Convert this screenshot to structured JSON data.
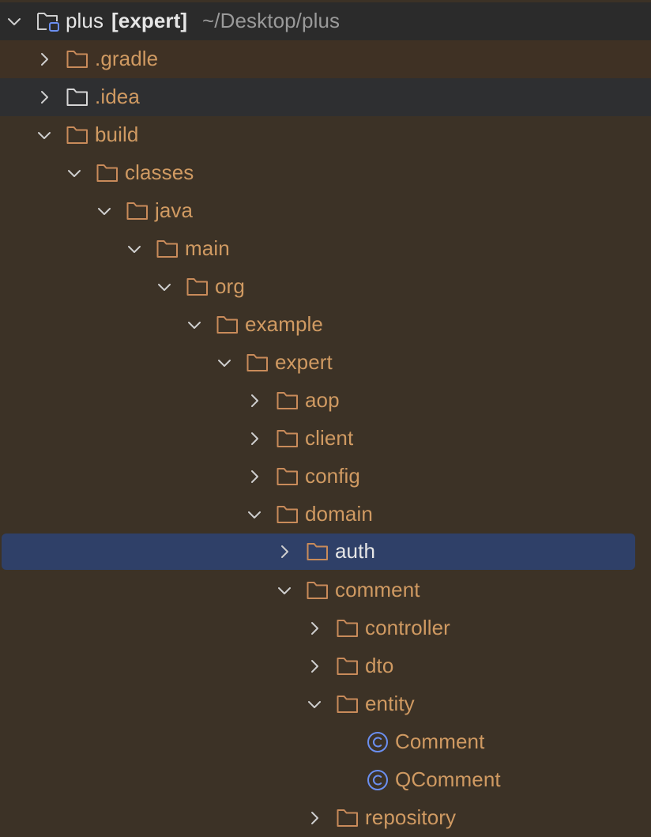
{
  "colors": {
    "background": "#3c3226",
    "folder_stroke": "#c98b5a",
    "folder_label": "#d09a62",
    "selected_row": "#2f4068",
    "class_icon": "#6b8ff0"
  },
  "project": {
    "name": "plus",
    "module": "[expert]",
    "path": "~/Desktop/plus",
    "icon": "project-folder-icon"
  },
  "tree": [
    {
      "label": ".gradle",
      "expanded": false,
      "kind": "folder"
    },
    {
      "label": ".idea",
      "expanded": false,
      "kind": "folder"
    },
    {
      "label": "build",
      "expanded": true,
      "kind": "folder"
    },
    {
      "label": "classes",
      "expanded": true,
      "kind": "folder"
    },
    {
      "label": "java",
      "expanded": true,
      "kind": "folder"
    },
    {
      "label": "main",
      "expanded": true,
      "kind": "folder"
    },
    {
      "label": "org",
      "expanded": true,
      "kind": "folder"
    },
    {
      "label": "example",
      "expanded": true,
      "kind": "folder"
    },
    {
      "label": "expert",
      "expanded": true,
      "kind": "folder"
    },
    {
      "label": "aop",
      "expanded": false,
      "kind": "folder"
    },
    {
      "label": "client",
      "expanded": false,
      "kind": "folder"
    },
    {
      "label": "config",
      "expanded": false,
      "kind": "folder"
    },
    {
      "label": "domain",
      "expanded": true,
      "kind": "folder"
    },
    {
      "label": "auth",
      "expanded": false,
      "kind": "folder",
      "selected": true
    },
    {
      "label": "comment",
      "expanded": true,
      "kind": "folder"
    },
    {
      "label": "controller",
      "expanded": false,
      "kind": "folder"
    },
    {
      "label": "dto",
      "expanded": false,
      "kind": "folder"
    },
    {
      "label": "entity",
      "expanded": true,
      "kind": "folder"
    },
    {
      "label": "Comment",
      "kind": "class"
    },
    {
      "label": "QComment",
      "kind": "class"
    },
    {
      "label": "repository",
      "expanded": false,
      "kind": "folder"
    }
  ]
}
